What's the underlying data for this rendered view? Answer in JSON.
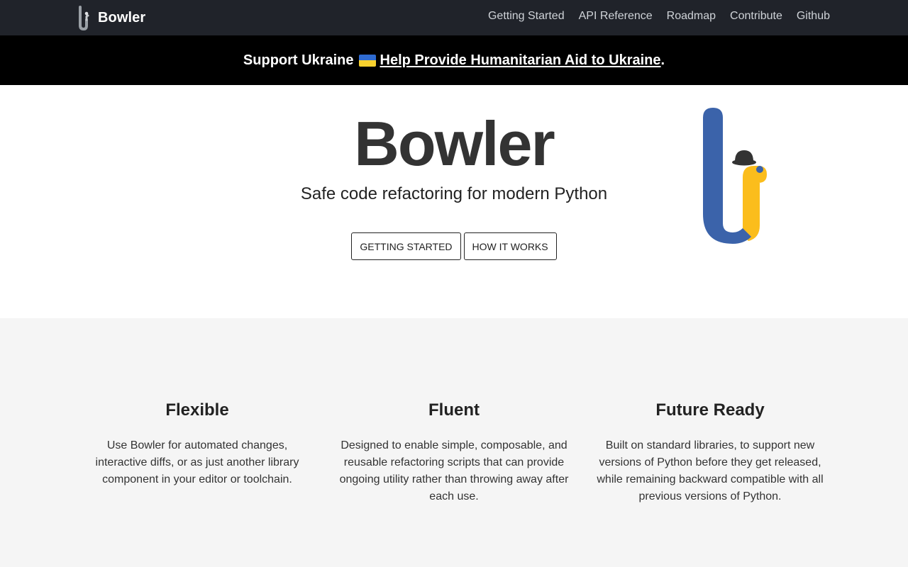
{
  "nav": {
    "brand": "Bowler",
    "links": [
      "Getting Started",
      "API Reference",
      "Roadmap",
      "Contribute",
      "Github"
    ]
  },
  "banner": {
    "prefix": "Support Ukraine",
    "flag_icon": "ukraine-flag-icon",
    "link_text": "Help Provide Humanitarian Aid to Ukraine",
    "suffix": "."
  },
  "hero": {
    "title": "Bowler",
    "tagline": "Safe code refactoring for modern Python",
    "buttons": [
      "GETTING STARTED",
      "HOW IT WORKS"
    ],
    "logo_icon": "bowler-logo-icon"
  },
  "features": [
    {
      "title": "Flexible",
      "body": "Use Bowler for automated changes, interactive diffs, or as just another library component in your editor or toolchain."
    },
    {
      "title": "Fluent",
      "body": "Designed to enable simple, composable, and reusable refactoring scripts that can provide ongoing utility rather than throwing away after each use."
    },
    {
      "title": "Future Ready",
      "body": "Built on standard libraries, to support new versions of Python before they get released, while remaining backward compatible with all previous versions of Python."
    }
  ],
  "colors": {
    "nav_bg": "#20232a",
    "banner_bg": "#000000",
    "logo_blue": "#3b63aa",
    "logo_yellow": "#fbbd1c",
    "hat": "#333333"
  }
}
